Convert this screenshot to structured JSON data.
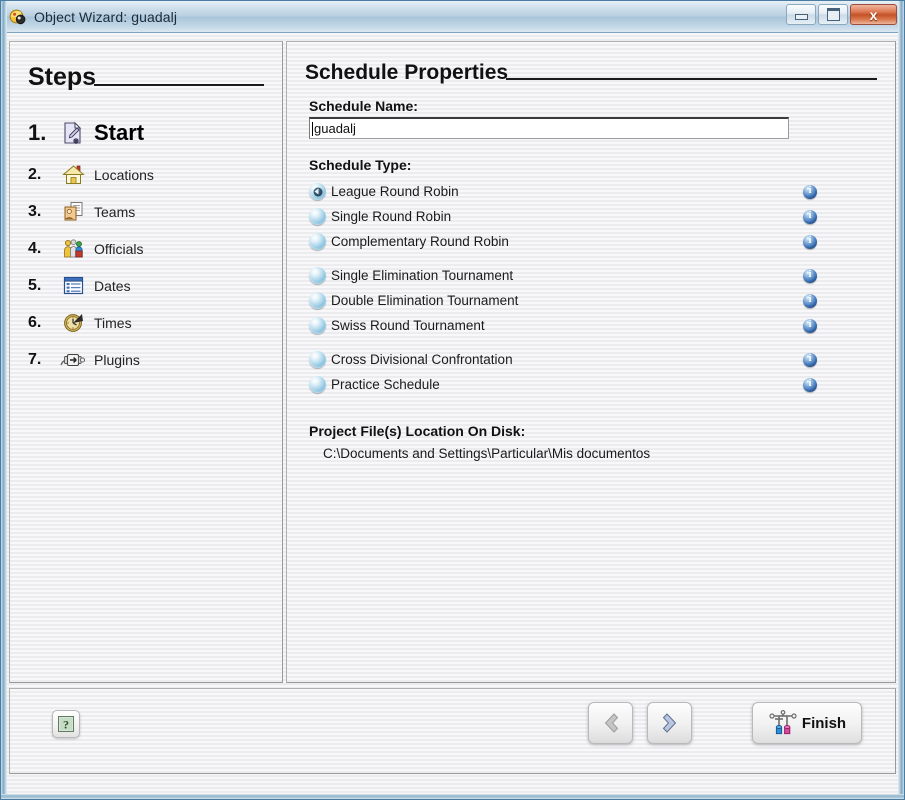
{
  "window": {
    "title": "Object Wizard: guadalj",
    "title_icon": "wizard-ball-icon",
    "buttons": {
      "minimize": "minimize-icon",
      "maximize": "maximize-icon",
      "close": "x"
    }
  },
  "sidebar": {
    "heading": "Steps",
    "items": [
      {
        "num": "1.",
        "label": "Start",
        "icon": "new-document-icon",
        "active": true
      },
      {
        "num": "2.",
        "label": "Locations",
        "icon": "house-icon",
        "active": false
      },
      {
        "num": "3.",
        "label": "Teams",
        "icon": "cards-icon",
        "active": false
      },
      {
        "num": "4.",
        "label": "Officials",
        "icon": "people-icon",
        "active": false
      },
      {
        "num": "5.",
        "label": "Dates",
        "icon": "calendar-icon",
        "active": false
      },
      {
        "num": "6.",
        "label": "Times",
        "icon": "clock-icon",
        "active": false
      },
      {
        "num": "7.",
        "label": "Plugins",
        "icon": "plug-icon",
        "active": false
      }
    ]
  },
  "main": {
    "heading": "Schedule Properties",
    "schedule_name": {
      "label": "Schedule Name:",
      "value": "guadalj",
      "placeholder": ""
    },
    "schedule_type": {
      "label": "Schedule Type:",
      "options": [
        {
          "label": "League Round Robin",
          "selected": true,
          "gap": false,
          "info": "info-icon"
        },
        {
          "label": "Single Round Robin",
          "selected": false,
          "gap": false,
          "info": "info-icon"
        },
        {
          "label": "Complementary Round Robin",
          "selected": false,
          "gap": false,
          "info": "info-icon"
        },
        {
          "label": "Single Elimination Tournament",
          "selected": false,
          "gap": true,
          "info": "info-icon"
        },
        {
          "label": "Double Elimination Tournament",
          "selected": false,
          "gap": false,
          "info": "info-icon"
        },
        {
          "label": "Swiss Round Tournament",
          "selected": false,
          "gap": false,
          "info": "info-icon"
        },
        {
          "label": "Cross Divisional Confrontation",
          "selected": false,
          "gap": true,
          "info": "info-icon"
        },
        {
          "label": "Practice Schedule",
          "selected": false,
          "gap": false,
          "info": "info-icon"
        }
      ]
    },
    "project_location": {
      "label": "Project File(s) Location On Disk:",
      "path": "C:\\Documents and Settings\\Particular\\Mis documentos"
    }
  },
  "footer": {
    "help_button": "help-question-icon",
    "back_button": "back-chevron-icon",
    "next_button": "next-chevron-icon",
    "finish_button": "Finish",
    "finish_icon": "bracket-icon"
  },
  "colors": {
    "titlebar": "#b9d0e1",
    "close_button": "#c45227",
    "radio_blue": "#6aaed2",
    "info_blue": "#1d4a86",
    "panel_bg": "#f2f2f4"
  }
}
